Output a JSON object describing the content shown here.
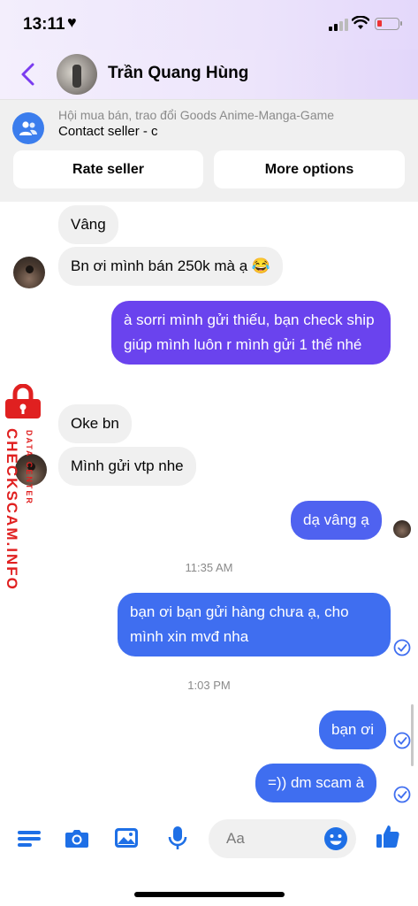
{
  "status_bar": {
    "time": "13:11"
  },
  "header": {
    "contact_name": "Trần Quang Hùng"
  },
  "group_panel": {
    "group_name": "Hội mua bán, trao đổi Goods Anime-Manga-Game",
    "subtitle": "Contact seller - c",
    "rate_seller": "Rate seller",
    "more_options": "More options"
  },
  "messages": [
    {
      "side": "in",
      "text": "Vâng"
    },
    {
      "side": "in",
      "text": "Bn ơi mình bán 250k mà ạ 😂"
    },
    {
      "side": "out",
      "text": "à sorri mình gửi thiếu, bạn check ship giúp mình luôn r mình gửi 1 thể nhé"
    },
    {
      "side": "in",
      "text": "Oke bn"
    },
    {
      "side": "in",
      "text": "Mình gửi vtp nhe"
    },
    {
      "side": "out",
      "text": "dạ vâng ạ"
    },
    {
      "side": "out",
      "text": "bạn ơi bạn gửi hàng chưa ạ, cho mình xin mvđ nha"
    },
    {
      "side": "out",
      "text": "bạn ơi"
    },
    {
      "side": "out",
      "text": "=)) dm scam à"
    }
  ],
  "timestamps": [
    "11:35 AM",
    "1:03 PM"
  ],
  "composer": {
    "placeholder": "Aa"
  },
  "watermark": {
    "main": "CHECKSCAM.INFO",
    "small": "DATA CENTER"
  },
  "colors": {
    "accent": "#4f62f0",
    "purple": "#6a43ee",
    "watermark": "#e02020",
    "icon_blue": "#1e6fe6"
  }
}
